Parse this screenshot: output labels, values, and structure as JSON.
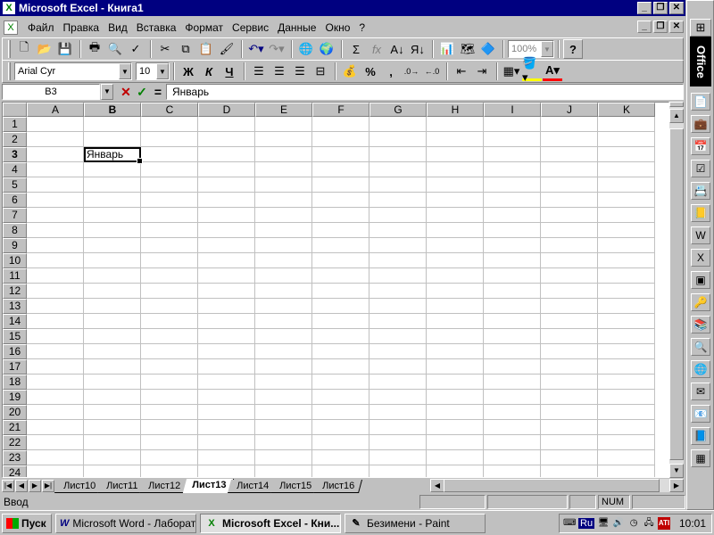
{
  "window": {
    "title": "Microsoft Excel - Книга1"
  },
  "menu": [
    "Файл",
    "Правка",
    "Вид",
    "Вставка",
    "Формат",
    "Сервис",
    "Данные",
    "Окно",
    "?"
  ],
  "toolbar": {
    "zoom": "100%",
    "font_name": "Arial Cyr",
    "font_size": "10",
    "bold": "Ж",
    "italic": "К",
    "underline": "Ч",
    "sum": "Σ",
    "fx": "fx",
    "percent": "%",
    "comma": ",",
    "help": "?"
  },
  "formula_bar": {
    "name_box": "B3",
    "equals": "=",
    "content": "Январь"
  },
  "columns": [
    "A",
    "B",
    "C",
    "D",
    "E",
    "F",
    "G",
    "H",
    "I",
    "J",
    "K"
  ],
  "active_column": "B",
  "active_row": 3,
  "row_count": 24,
  "cells": {
    "B3": "Январь"
  },
  "sheet_tabs": [
    "Лист10",
    "Лист11",
    "Лист12",
    "Лист13",
    "Лист14",
    "Лист15",
    "Лист16"
  ],
  "active_tab": "Лист13",
  "status": {
    "mode": "Ввод",
    "num": "NUM"
  },
  "office_bar": {
    "label": "Office"
  },
  "taskbar": {
    "start_label": "Пуск",
    "tasks": [
      {
        "label": "Microsoft Word - Лаборат...",
        "icon": "W",
        "active": false
      },
      {
        "label": "Microsoft Excel - Кни...",
        "icon": "X",
        "active": true
      },
      {
        "label": "Безимени - Paint",
        "icon": "✎",
        "active": false
      }
    ],
    "tray_lang": "Ru",
    "clock": "10:01"
  },
  "colors": {
    "title_bar": "#000080",
    "face": "#c0c0c0",
    "grid_line": "#c0c0c0",
    "excel_green": "#008000"
  }
}
